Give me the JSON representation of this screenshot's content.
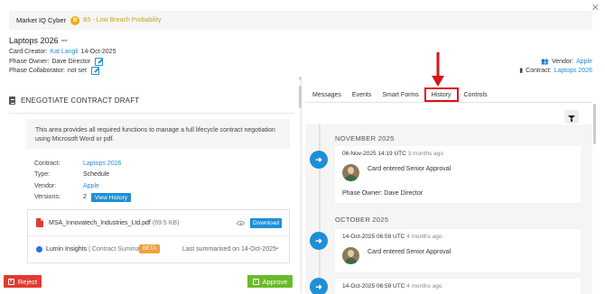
{
  "banner": {
    "company": "Market IQ Cyber",
    "badge": "B",
    "risk": "B5 - Low Breach Probability"
  },
  "card": {
    "title": "Laptops 2026",
    "creator_label": "Card Creator:",
    "creator_name": "Kat Langli",
    "creator_date": "14-Oct-2025",
    "owner_label": "Phase Owner:",
    "owner_name": "Dave Director",
    "collab_label": "Phase Collaborator:",
    "collab_value": "not set",
    "vendor_label": "Vendor:",
    "vendor_value": "Apple",
    "contract_label": "Contract:",
    "contract_value": "Laptops 2026"
  },
  "section": {
    "title": "ENEGOTIATE CONTRACT DRAFT",
    "description": "This area provides all required functions to manage a full lifecycle contract negotiation using Microsoft Word or pdf.",
    "fields": {
      "contract_label": "Contract:",
      "contract_value": "Laptops 2026",
      "type_label": "Type:",
      "type_value": "Schedule",
      "vendor_label": "Vendor:",
      "vendor_value": "Apple",
      "versions_label": "Versions:",
      "versions_value": "2",
      "view_history": "View History"
    },
    "file": {
      "name": "MSA_Innovatech_Industries_Ltd.pdf",
      "size": "(69.5 KB)",
      "download": "Download",
      "lumin": "Lumin Insights",
      "lumin_sub": "| Contract Summary",
      "beta": "BETA",
      "summarised": "Last summarised on 14-Oct-2025"
    }
  },
  "actions": {
    "reject": "Reject",
    "approve": "Approve"
  },
  "tabs": [
    "Messages",
    "Events",
    "Smart Forms",
    "History",
    "Controls"
  ],
  "active_tab": "History",
  "history": {
    "months": [
      "NOVEMBER 2025",
      "OCTOBER 2025"
    ],
    "events": [
      {
        "time": "06-Nov-2025 14:19 UTC",
        "ago": "3 months ago",
        "text": "Card entered Senior Approval",
        "owner": "Phase Owner: Dave Director"
      },
      {
        "time": "14-Oct-2025 06:59 UTC",
        "ago": "4 months ago",
        "text": "Card entered Senior Approval"
      },
      {
        "time": "14-Oct-2025 06:59 UTC",
        "ago": "4 months ago"
      }
    ]
  },
  "colors": {
    "accent": "#1f8fd6",
    "reject": "#e03c31",
    "approve": "#6abb2a",
    "highlight": "#d9141b",
    "beta": "#f0a040"
  }
}
